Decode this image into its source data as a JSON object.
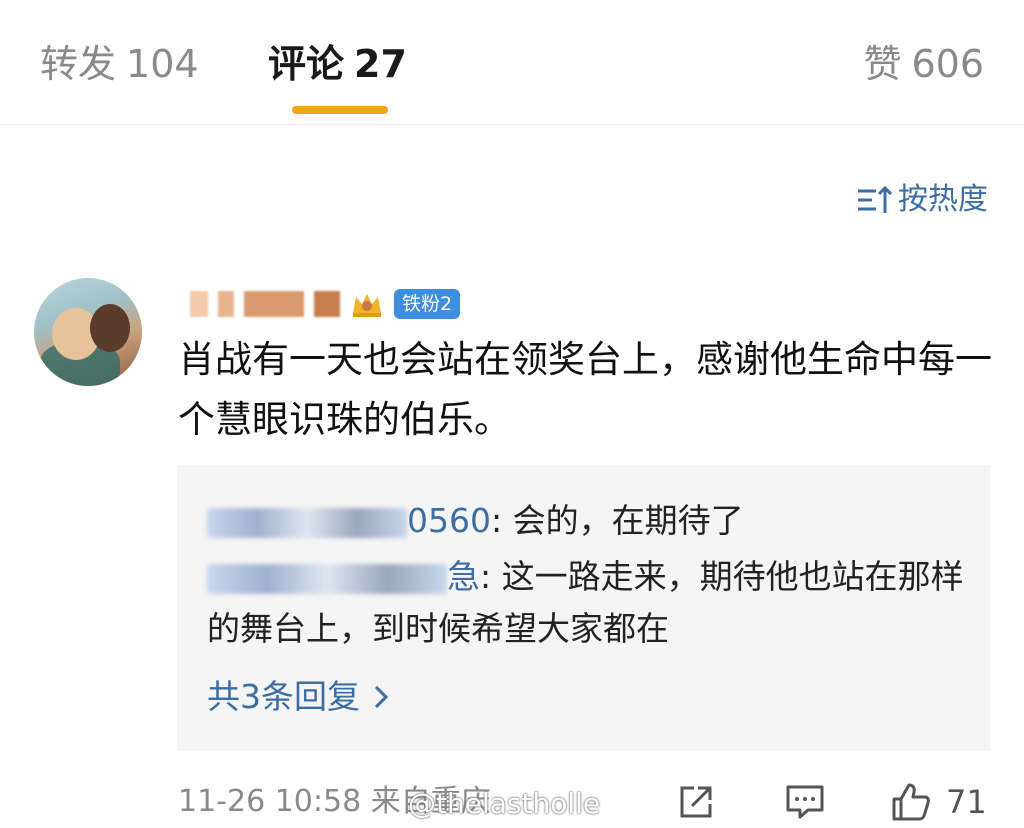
{
  "tabs": {
    "repost": {
      "label": "转发",
      "count": "104"
    },
    "comments": {
      "label": "评论",
      "count": "27"
    },
    "likes": {
      "label": "赞",
      "count": "606"
    },
    "active": "comments",
    "accent_color": "#f2a21b"
  },
  "sort": {
    "label": "按热度",
    "icon": "sort-icon"
  },
  "comment": {
    "fan_badge": "铁粉2",
    "text": "肖战有一天也会站在领奖台上，感谢他生命中每一个慧眼识珠的伯乐。",
    "replies": [
      {
        "author_visible": "0560",
        "text": ": 会的，在期待了"
      },
      {
        "author_visible": "急",
        "text": ": 这一路走来，期待他也站在那样的舞台上，到时候希望大家都在"
      }
    ],
    "more_replies": "共3条回复",
    "time": "11-26 10:58",
    "source": "来自重庆",
    "like_count": "71"
  },
  "watermark": "@thelastholle",
  "colors": {
    "link": "#3c6da5",
    "muted": "#8a8a8a",
    "reply_bg": "#f5f5f5",
    "badge": "#3e8de0"
  }
}
